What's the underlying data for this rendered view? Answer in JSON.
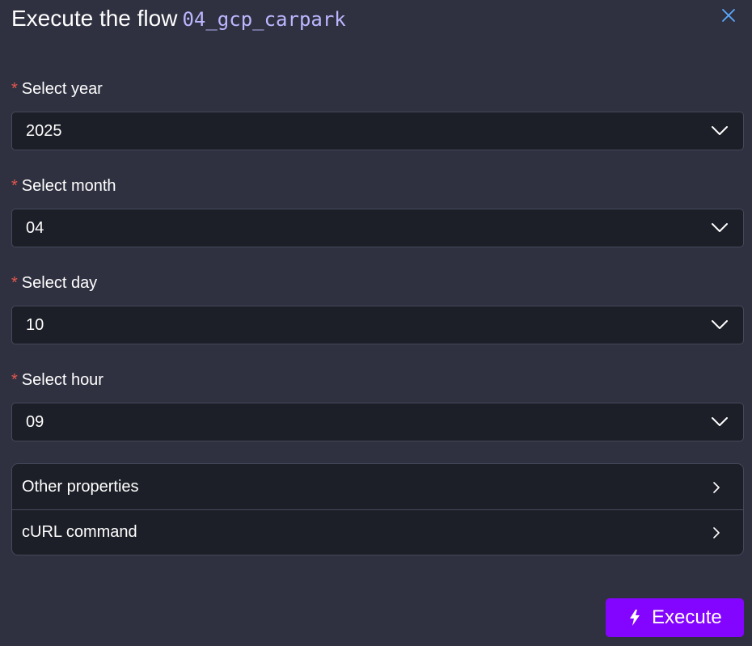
{
  "header": {
    "title": "Execute the flow",
    "flow_id": "04_gcp_carpark",
    "close_icon": "close-icon"
  },
  "fields": [
    {
      "label": "Select year",
      "required_mark": "*",
      "value": "2025"
    },
    {
      "label": "Select month",
      "required_mark": "*",
      "value": "04"
    },
    {
      "label": "Select day",
      "required_mark": "*",
      "value": "10"
    },
    {
      "label": "Select hour",
      "required_mark": "*",
      "value": "09"
    }
  ],
  "collapsibles": [
    {
      "label": "Other properties",
      "icon": "chevron-right-icon"
    },
    {
      "label": "cURL command",
      "icon": "chevron-right-icon"
    }
  ],
  "actions": {
    "execute_label": "Execute",
    "execute_icon": "lightning-bolt-icon"
  },
  "colors": {
    "background": "#2f3140",
    "input_background": "#1d1f28",
    "border": "#454859",
    "required": "#e8574e",
    "accent": "#8405ff",
    "flow_id": "#bcb6ff",
    "close_icon": "#5aa9ff"
  }
}
